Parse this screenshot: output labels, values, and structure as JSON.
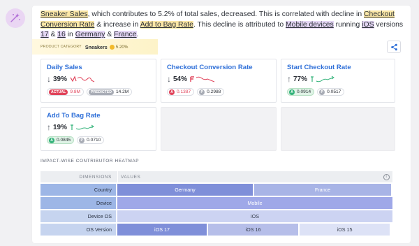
{
  "summary": {
    "t1": "Sneaker Sales",
    "t2": ", which contributes to 5.2% of total sales, decreased. This is correlated with decline in ",
    "t3": "Checkout Conversion Rate",
    "t4": " & increase in ",
    "t5": "Add to Bag Rate",
    "t6": ". This decline is attributed to ",
    "t7": "Mobile devices",
    "t8": " running ",
    "t9": "iOS",
    "t10": " versions ",
    "t11": "17",
    "t12": " & ",
    "t13": "16",
    "t14": " in ",
    "t15": "Germany",
    "t16": " & ",
    "t17": "France",
    "t18": "."
  },
  "category": {
    "label": "PRODUCT CATEGORY",
    "value": "Sneakers",
    "pct": "5.20%"
  },
  "metrics": {
    "daily": {
      "title": "Daily Sales",
      "arrow": "↓",
      "pct": "39%",
      "actual_tag": "ACTUAL",
      "actual": "9.8M",
      "pred_tag": "PREDICTED",
      "pred": "14.2M"
    },
    "checkout": {
      "title": "Checkout Conversion Rate",
      "arrow": "↓",
      "pct": "54%",
      "a": "0.1387",
      "b": "0.2988"
    },
    "start": {
      "title": "Start Checkout Rate",
      "arrow": "↑",
      "pct": "77%",
      "a": "0.0914",
      "b": "0.0517"
    },
    "bag": {
      "title": "Add To Bag Rate",
      "arrow": "↑",
      "pct": "19%",
      "a": "0.0845",
      "b": "0.0710"
    }
  },
  "heatmap": {
    "title": "IMPACT-WISE CONTRIBUTOR HEATMAP",
    "dim_header": "DIMENSIONS",
    "val_header": "VALUES",
    "info_icon": "i",
    "rows": [
      {
        "dim": "Country",
        "cells": [
          "Germany",
          "France"
        ]
      },
      {
        "dim": "Device",
        "cells": [
          "Mobile"
        ]
      },
      {
        "dim": "Device OS",
        "cells": [
          "iOS"
        ]
      },
      {
        "dim": "OS Version",
        "cells": [
          "iOS 17",
          "iOS 16",
          "iOS 15"
        ]
      }
    ]
  },
  "colors": {
    "accent_blue": "#2e6fd8",
    "highlight_yellow": "#fbe7a6",
    "highlight_purple": "#e3d5f3",
    "down_red": "#e0435a",
    "up_green": "#34b37a"
  },
  "icons": {
    "avatar": "sparkle-wand-icon",
    "share": "share-icon"
  }
}
